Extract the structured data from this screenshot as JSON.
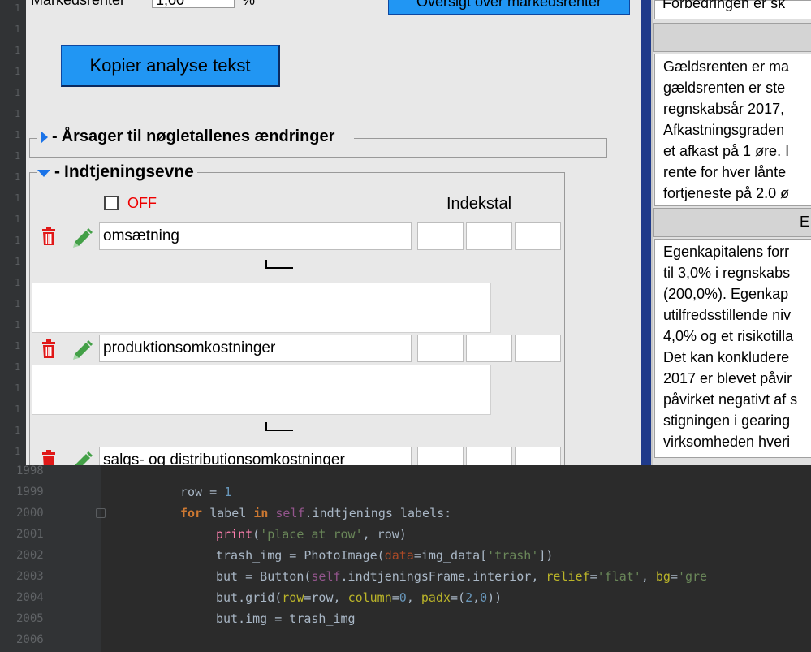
{
  "ide": {
    "line_numbers": [
      "1998",
      "1999",
      "2000",
      "2001",
      "2002",
      "2003",
      "2004",
      "2005",
      "2006"
    ],
    "gutter_stub": "1"
  },
  "app": {
    "top": {
      "field_label": "Markedsrenter",
      "field_value": "1,00",
      "pct": "%",
      "overview_button": "Oversigt over markedsrenter"
    },
    "copy_button": "Kopier analyse tekst",
    "section_causes": {
      "title": "Årsager til nøgletallenes ændringer"
    },
    "section_earnings": {
      "title": "Indtjeningsevne",
      "toggle_label": "OFF",
      "index_header": "Indekstal",
      "rows": [
        {
          "label": "omsætning"
        },
        {
          "label": "produktionsomkostninger"
        },
        {
          "label": "salgs- og distributionsomkostninger"
        }
      ]
    },
    "right_panel": {
      "top_line": "Forbedringen er sk",
      "header1": "",
      "block1": [
        "Gældsrenten er ma",
        "gældsrenten er ste",
        "regnskabsår 2017,",
        "Afkastningsgraden",
        "et afkast på 1 øre. I",
        "rente for hver lånte",
        "fortjeneste på 2.0 ø"
      ],
      "header2": "E",
      "block2": [
        "Egenkapitalens forr",
        "til 3,0% i regnskabs",
        "(200,0%). Egenkap",
        "utilfredsstillende niv",
        "4,0% og et risikotilla",
        "Det kan konkludere",
        "2017 er blevet påvir",
        "påvirket negativt af s",
        "stigningen i gearing",
        "virksomheden hveri"
      ]
    }
  },
  "colors": {
    "button_blue": "#2196f3",
    "divider_blue": "#1f3a8a",
    "off_red": "#ee0000",
    "expander_blue": "#1a73e8"
  }
}
